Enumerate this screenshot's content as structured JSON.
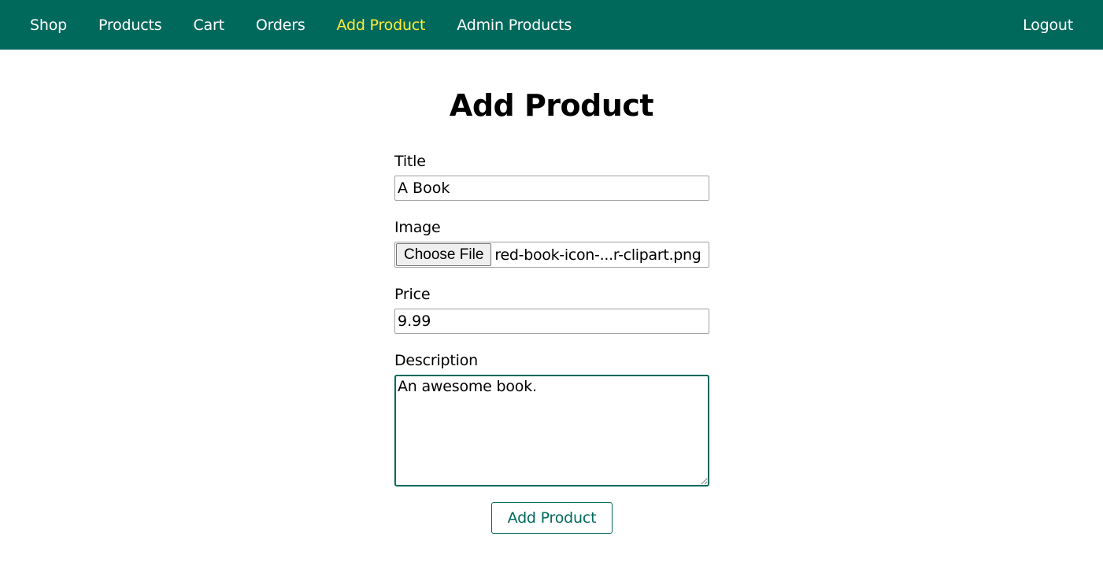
{
  "nav": {
    "items": [
      {
        "label": "Shop",
        "active": false
      },
      {
        "label": "Products",
        "active": false
      },
      {
        "label": "Cart",
        "active": false
      },
      {
        "label": "Orders",
        "active": false
      },
      {
        "label": "Add Product",
        "active": true
      },
      {
        "label": "Admin Products",
        "active": false
      }
    ],
    "logout_label": "Logout",
    "colors": {
      "background": "#00695c",
      "text": "#ffffff",
      "active": "#ffeb3b"
    }
  },
  "page": {
    "title": "Add Product"
  },
  "form": {
    "title": {
      "label": "Title",
      "value": "A Book"
    },
    "image": {
      "label": "Image",
      "button_label": "Choose File",
      "file_name": "red-book-icon-...r-clipart.png"
    },
    "price": {
      "label": "Price",
      "value": "9.99"
    },
    "description": {
      "label": "Description",
      "value": "An awesome book."
    },
    "submit_label": "Add Product"
  }
}
